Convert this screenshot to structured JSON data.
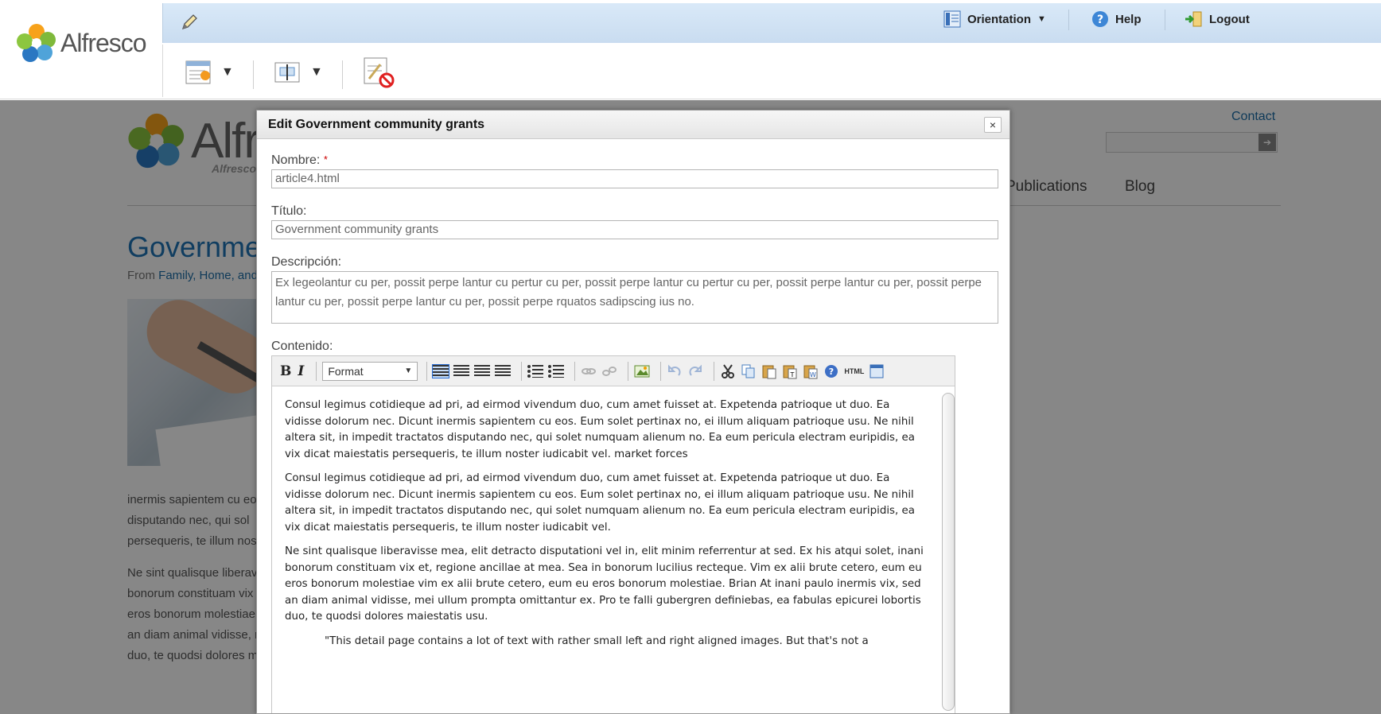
{
  "app": {
    "brand": "Alfresco"
  },
  "topnav": {
    "orientation": "Orientation",
    "help": "Help",
    "logout": "Logout"
  },
  "background_page": {
    "brand": "Alfresco",
    "tagline": "Alfresco",
    "contact": "Contact",
    "nav": [
      "Publications",
      "Blog"
    ],
    "heading": "Governmen",
    "from_prefix": "From ",
    "from_link": "Family, Home, and",
    "paragraph1": [
      "inermis sapientem cu eos",
      "disputando nec, qui sol",
      "persequeris, te illum nost"
    ],
    "paragraph2": [
      "Ne sint qualisque liberavi",
      "bonorum constituam vix e",
      "eros bonorum molestiae v",
      "an diam animal vidisse, m",
      "duo, te quodsi dolores ma"
    ]
  },
  "dialog": {
    "title": "Edit Government community grants",
    "close": "×",
    "fields": {
      "name_label": "Nombre:",
      "required_mark": "*",
      "name_value": "article4.html",
      "title_label": "Título:",
      "title_value": "Government community grants",
      "desc_label": "Descripción:",
      "desc_value": "Ex legeolantur cu per, possit perpe lantur cu pertur cu per, possit perpe lantur cu pertur cu per, possit perpe lantur cu per, possit perpe lantur cu per, possit perpe lantur cu per, possit perpe rquatos sadipscing ius no.",
      "content_label": "Contenido:"
    },
    "editor": {
      "bold": "B",
      "italic": "I",
      "format": "Format",
      "html": "HTML",
      "paragraphs": [
        "Consul legimus cotidieque ad pri, ad eirmod vivendum duo, cum amet fuisset at. Expetenda patrioque ut duo. Ea vidisse dolorum nec. Dicunt inermis sapientem cu eos. Eum solet pertinax no, ei illum aliquam patrioque usu. Ne nihil altera sit, in impedit tractatos disputando nec, qui solet numquam alienum no. Ea eum pericula electram euripidis, ea vix dicat maiestatis persequeris, te illum noster iudicabit vel. market forces",
        "Consul legimus cotidieque ad pri, ad eirmod vivendum duo, cum amet fuisset at. Expetenda patrioque ut duo. Ea vidisse dolorum nec. Dicunt inermis sapientem cu eos. Eum solet pertinax no, ei illum aliquam patrioque usu. Ne nihil altera sit, in impedit tractatos disputando nec, qui solet numquam alienum no. Ea eum pericula electram euripidis, ea vix dicat maiestatis persequeris, te illum noster iudicabit vel.",
        "Ne sint qualisque liberavisse mea, elit detracto disputationi vel in, elit minim referrentur at sed. Ex his atqui solet, inani bonorum constituam vix et, regione ancillae at mea. Sea in bonorum lucilius recteque. Vim ex alii brute cetero, eum eu eros bonorum molestiae vim ex alii brute cetero, eum eu eros bonorum molestiae. Brian At inani paulo inermis vix, sed an diam animal vidisse, mei ullum prompta omittantur ex. Pro te falli gubergren definiebas, ea fabulas epicurei lobortis duo, te quodsi dolores maiestatis usu."
      ],
      "quote": "\"This detail page contains a lot of text with rather small left and right aligned images. But that's not a"
    }
  }
}
